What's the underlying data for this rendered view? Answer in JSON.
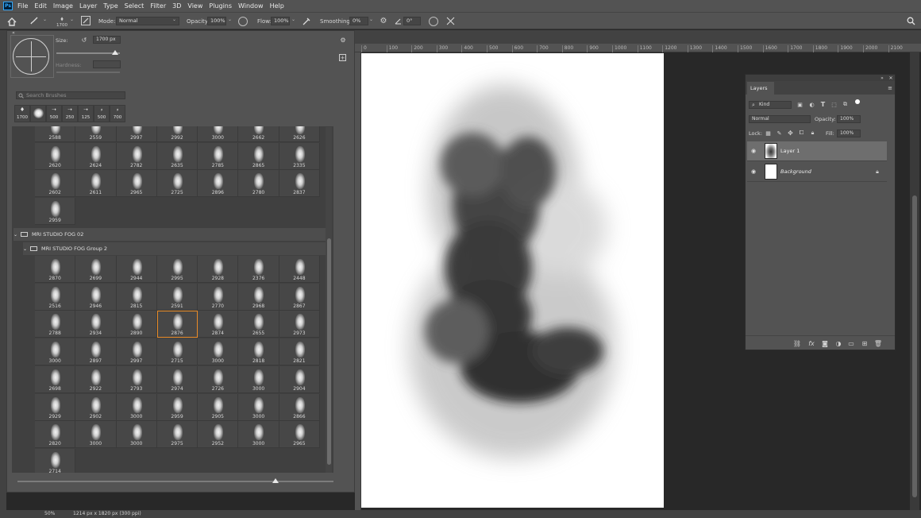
{
  "app": {
    "logo": "Ps"
  },
  "menu": [
    "File",
    "Edit",
    "Image",
    "Layer",
    "Type",
    "Select",
    "Filter",
    "3D",
    "View",
    "Plugins",
    "Window",
    "Help"
  ],
  "options_bar": {
    "brush_size": "1700",
    "mode_label": "Mode:",
    "mode_value": "Normal",
    "opacity_label": "Opacity:",
    "opacity_value": "100%",
    "flow_label": "Flow:",
    "flow_value": "100%",
    "smoothing_label": "Smoothing:",
    "smoothing_value": "0%",
    "angle_value": "0°"
  },
  "brush_panel": {
    "size_label": "Size:",
    "size_value": "1700 px",
    "hardness_label": "Hardness:",
    "search_placeholder": "Search Brushes",
    "recent_brushes": [
      "1700",
      "",
      "500",
      "250",
      "125",
      "500",
      "700"
    ],
    "top_rows": [
      [
        "2588",
        "2559",
        "2997",
        "2992",
        "3000",
        "2662",
        "2626"
      ],
      [
        "2620",
        "2624",
        "2782",
        "2635",
        "2785",
        "2865",
        "2335"
      ],
      [
        "2602",
        "2611",
        "2965",
        "2725",
        "2896",
        "2780",
        "2837"
      ],
      [
        "2959"
      ]
    ],
    "group_name": "MRI STUDIO FOG 02",
    "subgroup_name": "MRI STUDIO FOG Group 2",
    "group_rows": [
      [
        "2870",
        "2699",
        "2944",
        "2995",
        "2928",
        "2376",
        "2448"
      ],
      [
        "2516",
        "2946",
        "2815",
        "2591",
        "2770",
        "2968",
        "2867"
      ],
      [
        "2788",
        "2934",
        "2890",
        "2876",
        "2874",
        "2655",
        "2973"
      ],
      [
        "3000",
        "2897",
        "2997",
        "2715",
        "3000",
        "2818",
        "2821"
      ],
      [
        "2698",
        "2922",
        "2793",
        "2974",
        "2726",
        "3000",
        "2904"
      ],
      [
        "2929",
        "2902",
        "3000",
        "2959",
        "2905",
        "3000",
        "2866"
      ],
      [
        "2820",
        "3000",
        "3000",
        "2975",
        "2952",
        "3000",
        "2965"
      ],
      [
        "2714"
      ]
    ],
    "selected_brush": "2876"
  },
  "ruler": [
    "0",
    "100",
    "200",
    "300",
    "400",
    "500",
    "600",
    "700",
    "800",
    "900",
    "1000",
    "1100",
    "1200",
    "1300",
    "1400",
    "1500",
    "1600",
    "1700",
    "1800",
    "1900",
    "2000",
    "2100"
  ],
  "layers_panel": {
    "title": "Layers",
    "kind_label": "Kind",
    "blend_mode": "Normal",
    "opacity_label": "Opacity:",
    "opacity_value": "100%",
    "lock_label": "Lock:",
    "fill_label": "Fill:",
    "fill_value": "100%",
    "layers": [
      {
        "name": "Layer 1",
        "active": true
      },
      {
        "name": "Background",
        "active": false
      }
    ]
  },
  "status": {
    "zoom": "50%",
    "doc_info": "1214 px x 1820 px (300 ppi)"
  },
  "colors": {
    "accent_selected": "#e98b27",
    "panel_bg": "#535353",
    "workspace_bg": "#282828"
  }
}
